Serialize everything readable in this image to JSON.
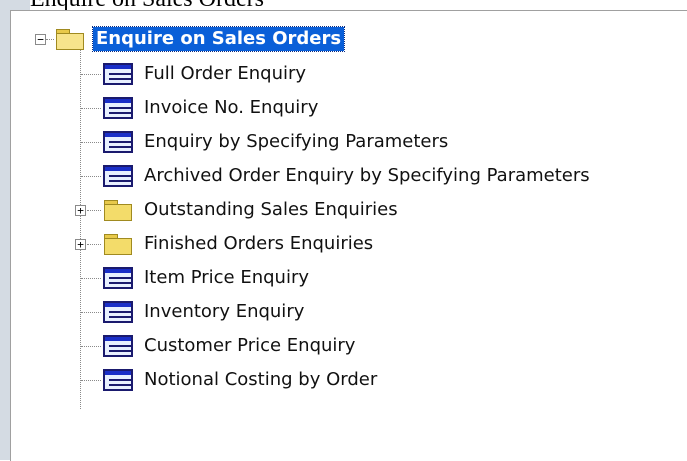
{
  "caption": "Enquire on Sales Orders",
  "tree": {
    "root": {
      "label": "Enquire on Sales Orders",
      "expanded": true,
      "selected": true
    },
    "items": [
      {
        "label": "Full Order Enquiry",
        "kind": "form-icon"
      },
      {
        "label": "Invoice No. Enquiry",
        "kind": "form-icon"
      },
      {
        "label": "Enquiry by Specifying Parameters",
        "kind": "form-icon"
      },
      {
        "label": "Archived Order Enquiry by Specifying Parameters",
        "kind": "form-icon"
      },
      {
        "label": "Outstanding Sales Enquiries",
        "kind": "folder-icon",
        "expandable": true
      },
      {
        "label": "Finished Orders Enquiries",
        "kind": "folder-icon",
        "expandable": true
      },
      {
        "label": "Item Price Enquiry",
        "kind": "form-icon"
      },
      {
        "label": "Inventory Enquiry",
        "kind": "form-icon"
      },
      {
        "label": "Customer Price Enquiry",
        "kind": "form-icon"
      },
      {
        "label": "Notional Costing by Order",
        "kind": "form-icon"
      }
    ],
    "expander_collapse": "−",
    "expander_expand": "+"
  },
  "colors": {
    "selection": "#0a5fd8",
    "form_icon_border": "#1a1a6e",
    "folder": "#f3dc6a"
  }
}
